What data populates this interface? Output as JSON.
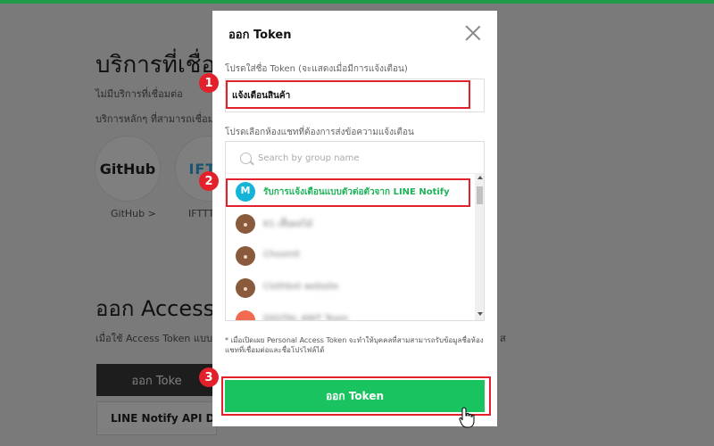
{
  "background": {
    "title": "บริการที่เชื่อมต่",
    "no_services": "ไม่มีบริการที่เชื่อมต่อ",
    "main_services": "บริการหลักๆ ที่สามารถเชื่อมต่",
    "services": [
      {
        "logo": "GitHub",
        "label": "GitHub >"
      },
      {
        "logo": "IFTT",
        "label": "IFTTT"
      }
    ],
    "access_title": "ออก Access T",
    "access_desc": "เมื่อใช้ Access Token แบบบุ",
    "access_desc_right": "ส",
    "issue_token_btn": "ออก Toke",
    "api_doc_btn": "LINE Notify API Doc"
  },
  "modal": {
    "title": "ออก Token",
    "token_name_label": "โปรดใส่ชื่อ Token (จะแสดงเมื่อมีการแจ้งเตือน)",
    "token_name_value": "แจ้งเตือนสินค้า",
    "chat_select_label": "โปรดเลือกห้องแชทที่ต้องการส่งข้อความแจ้งเตือน",
    "search_placeholder": "Search by group name",
    "chat_items": [
      {
        "name": "รับการแจ้งเตือนแบบตัวต่อตัวจาก LINE Notify",
        "avatar": "line-notify-icon"
      },
      {
        "name": "K1 เสื้อผลไม้",
        "avatar": "group-avatar-icon"
      },
      {
        "name": "Chosmit",
        "avatar": "group-avatar-icon"
      },
      {
        "name": "Clothbot website",
        "avatar": "group-avatar-icon"
      },
      {
        "name": "DIGITAL ANIT Team",
        "avatar": "group-avatar-icon"
      }
    ],
    "note": "* เมื่อเปิดเผย Personal Access Token จะทำให้บุคคลที่สามสามารถรับข้อมูลชื่อห้องแชทที่เชื่อมต่อและชื่อโปรไฟล์ได้",
    "submit_label": "ออก Token"
  },
  "annotations": [
    "1",
    "2",
    "3"
  ],
  "colors": {
    "accent_green": "#19c35f",
    "highlight_red": "#e2212a",
    "top_bar": "#1f9b4a"
  }
}
